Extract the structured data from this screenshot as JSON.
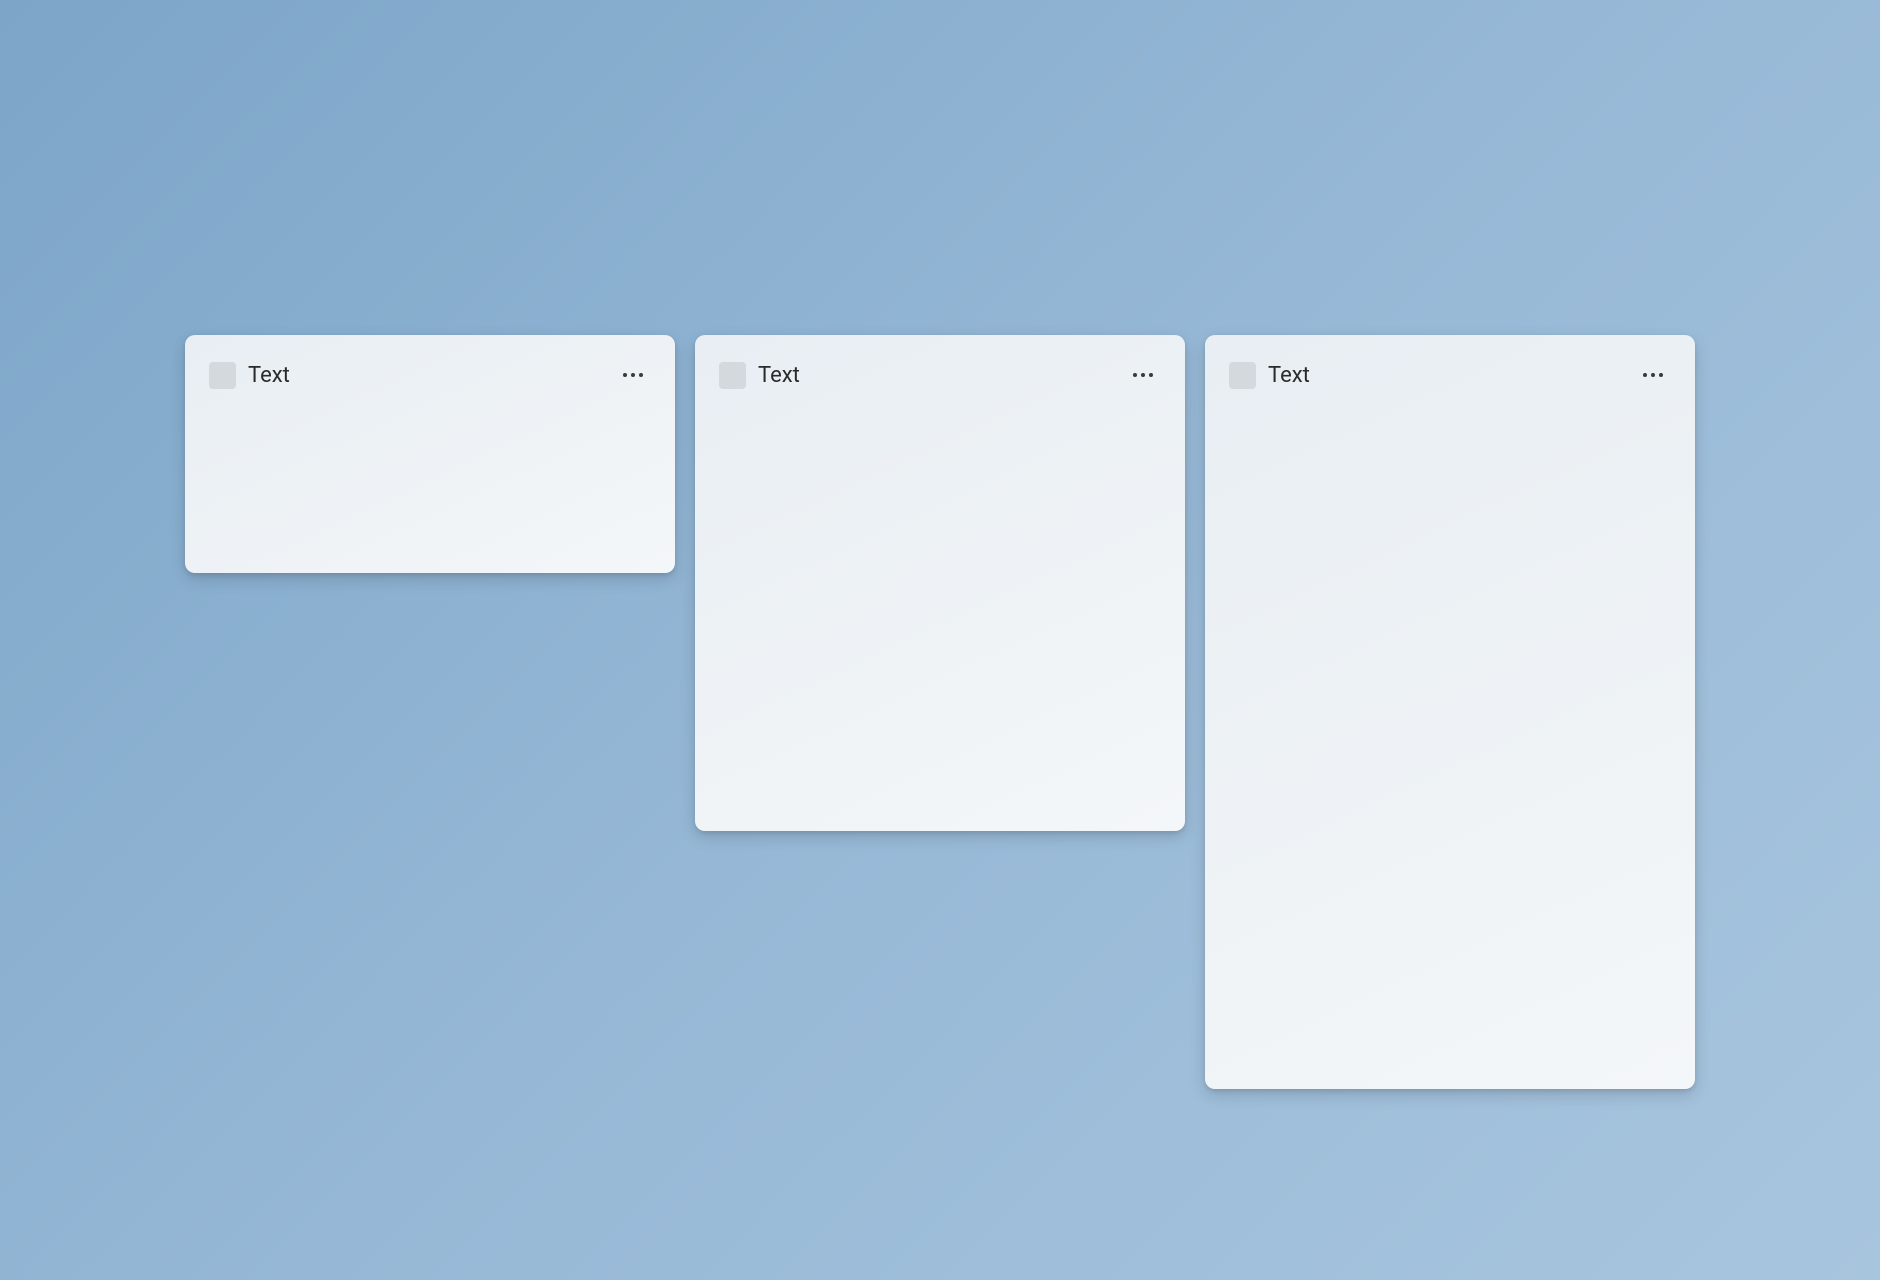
{
  "cards": [
    {
      "title": "Text",
      "size": "small"
    },
    {
      "title": "Text",
      "size": "medium"
    },
    {
      "title": "Text",
      "size": "large"
    }
  ]
}
